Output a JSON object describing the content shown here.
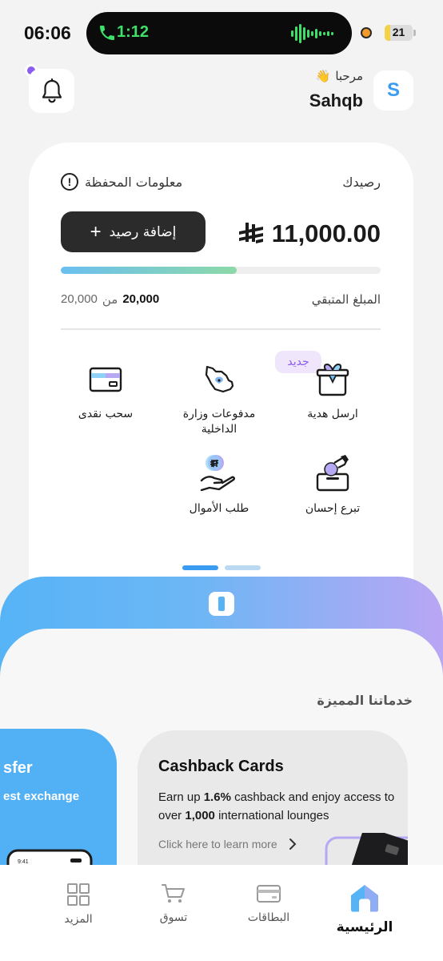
{
  "status_bar": {
    "time": "06:06",
    "call_timer": "1:12",
    "battery": "21",
    "battery_level": 0.21,
    "colors": {
      "call": "#3ee06a",
      "recording": "#f39a2b",
      "battery": "#f3d24a"
    }
  },
  "header": {
    "greeting": "مرحبا",
    "greeting_emoji": "👋",
    "username": "Sahqb",
    "avatar_initial": "S",
    "notification_icon": "bell-icon"
  },
  "wallet": {
    "balance_label": "رصيدك",
    "info_label": "معلومات المحفظة",
    "info_icon": "!",
    "add_balance_label": "إضافة رصيد",
    "add_balance_icon": "+",
    "balance_amount": "11,000.00",
    "currency_icon": "saudi-riyal-icon",
    "progress_fraction": 0.55,
    "remaining_label": "المبلغ المتبقي",
    "limit_used": "20,000",
    "limit_of": "من",
    "limit_total": "20,000"
  },
  "services": {
    "new_badge": "جديد",
    "items": [
      {
        "label": "ارسل هدية",
        "icon": "gift-box-icon"
      },
      {
        "label": "مدفوعات وزارة الداخلية",
        "icon": "saudi-map-icon"
      },
      {
        "label": "سحب نقدى",
        "icon": "card-icon"
      },
      {
        "label": "تبرع إحسان",
        "icon": "donation-box-icon"
      },
      {
        "label": "طلب الأموال",
        "icon": "request-money-icon"
      }
    ],
    "page_count": 2,
    "active_page": 1
  },
  "featured": {
    "section_title": "خدماتنا المميزة",
    "left_card": {
      "title": "sfer",
      "subtitle": "est exchange"
    },
    "cashback_card": {
      "title": "Cashback Cards",
      "description_pre": "Earn up ",
      "description_bold1": "1.6%",
      "description_mid": " cashback and enjoy access to over ",
      "description_bold2": "1,000",
      "description_post": " international lounges",
      "link_label": "Click here to learn more"
    }
  },
  "bottom_nav": {
    "items": [
      {
        "label": "الرئيسية",
        "icon": "home-icon",
        "active": true
      },
      {
        "label": "البطاقات",
        "icon": "cards-icon",
        "active": false
      },
      {
        "label": "تسوق",
        "icon": "cart-icon",
        "active": false
      },
      {
        "label": "المزيد",
        "icon": "grid-icon",
        "active": false
      }
    ]
  }
}
